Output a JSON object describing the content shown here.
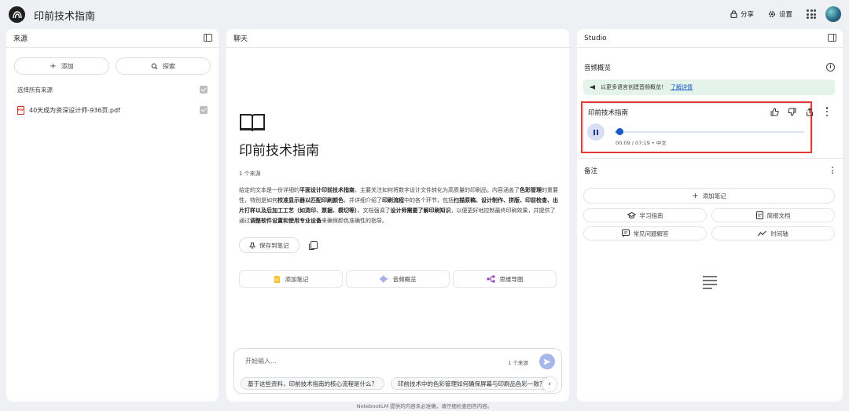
{
  "app": {
    "title": "印前技术指南"
  },
  "topbar": {
    "share_label": "分享",
    "settings_label": "设置"
  },
  "sources": {
    "header": "来源",
    "add_label": "添加",
    "discover_label": "探索",
    "select_all_label": "选择所有来源",
    "items": [
      {
        "name": "40天成为资深设计师-936页.pdf",
        "checked": true
      }
    ]
  },
  "chat": {
    "header": "聊天",
    "title": "印前技术指南",
    "source_count": "1 个来源",
    "summary": [
      {
        "t": "给定的文本是一份详细的",
        "b": false
      },
      {
        "t": "平面设计印前技术指南",
        "b": true
      },
      {
        "t": "，主要关注如何将数字设计文件转化为高质量的印刷品。内容涵盖了",
        "b": false
      },
      {
        "t": "色彩管理",
        "b": true
      },
      {
        "t": "的重要性，特别是如何",
        "b": false
      },
      {
        "t": "校准显示器以匹配印刷颜色",
        "b": true
      },
      {
        "t": "，并详细介绍了",
        "b": false
      },
      {
        "t": "印刷流程",
        "b": true
      },
      {
        "t": "中的各个环节，包括",
        "b": false
      },
      {
        "t": "扫描原稿、设计制作、拼版、印前检查、出片打样以及后加工工艺（如烫印、票据、模切等）",
        "b": true
      },
      {
        "t": "。文档强调了",
        "b": false
      },
      {
        "t": "设计师需要了解印刷知识",
        "b": true
      },
      {
        "t": "，以便更好地控制最终印刷效果，并提供了通过",
        "b": false
      },
      {
        "t": "调整软件设置和使用专业设备",
        "b": true
      },
      {
        "t": "来确保颜色准确性的指导。",
        "b": false
      }
    ],
    "save_label": "保存到笔记",
    "tools": [
      {
        "label": "添加笔记"
      },
      {
        "label": "音频概览"
      },
      {
        "label": "思维导图"
      }
    ],
    "input": {
      "placeholder": "开始输入...",
      "source_count": "1 个来源"
    },
    "suggestions": [
      "基于这些资料，印前技术指南的核心流程是什么？",
      "印前技术中的色彩管理如何确保屏幕与印刷品色彩一致？"
    ],
    "footer": "NotebookLM 提供的内容未必准确，请仔细检查回答内容。"
  },
  "studio": {
    "header": "Studio",
    "audio_overview_label": "音频概览",
    "promo_text": "以更多语言创建音频概览！",
    "promo_link": "了解详情",
    "audio": {
      "title": "印前技术指南",
      "time": "00:09 / 07:19 • 中文",
      "progress": 0.0205
    },
    "notes_label": "备注",
    "add_note_label": "添加笔记",
    "note_buttons": [
      {
        "label": "学习指南"
      },
      {
        "label": "简报文档"
      },
      {
        "label": "常见问题解答"
      },
      {
        "label": "时间轴"
      }
    ]
  },
  "colors": {
    "accent": "#1a57c9",
    "highlight_border": "#e53935",
    "promo_bg": "#e4f4ea",
    "send_btn": "#a8b7ea"
  },
  "icons": [
    "notebook-logo-icon",
    "lock-icon",
    "gear-icon",
    "apps-grid-icon",
    "panel-toggle-icon",
    "plus-icon",
    "search-icon",
    "checkbox-checked-icon",
    "pdf-icon",
    "book-icon",
    "pin-icon",
    "copy-icon",
    "note-icon",
    "audio-wave-icon",
    "mind-map-icon",
    "send-icon",
    "chevron-right-icon",
    "info-icon",
    "megaphone-icon",
    "thumb-up-icon",
    "thumb-down-icon",
    "share-icon",
    "more-vert-icon",
    "pause-icon",
    "school-icon",
    "document-icon",
    "faq-icon",
    "timeline-icon",
    "notes-placeholder-icon"
  ]
}
